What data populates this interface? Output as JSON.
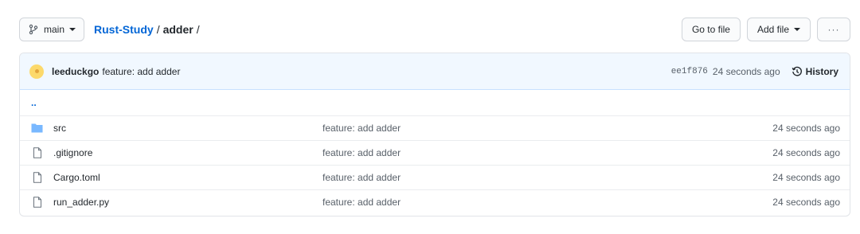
{
  "topbar": {
    "branch": "main",
    "breadcrumb": {
      "repo": "Rust-Study",
      "sep1": "/",
      "current": "adder",
      "sep2": "/"
    },
    "go_to_file": "Go to file",
    "add_file": "Add file",
    "more": "···"
  },
  "commit": {
    "author": "leeduckgo",
    "message": "feature: add adder",
    "sha": "ee1f876",
    "time": "24 seconds ago",
    "history": "History"
  },
  "parent_dir": "..",
  "files": [
    {
      "icon": "folder-icon",
      "name": "src",
      "message": "feature: add adder",
      "time": "24 seconds ago"
    },
    {
      "icon": "file-icon",
      "name": ".gitignore",
      "message": "feature: add adder",
      "time": "24 seconds ago"
    },
    {
      "icon": "file-icon",
      "name": "Cargo.toml",
      "message": "feature: add adder",
      "time": "24 seconds ago"
    },
    {
      "icon": "file-icon",
      "name": "run_adder.py",
      "message": "feature: add adder",
      "time": "24 seconds ago"
    }
  ],
  "colors": {
    "link": "#0366d6",
    "folder": "#79b8ff",
    "commit_bg": "#f1f8ff"
  }
}
